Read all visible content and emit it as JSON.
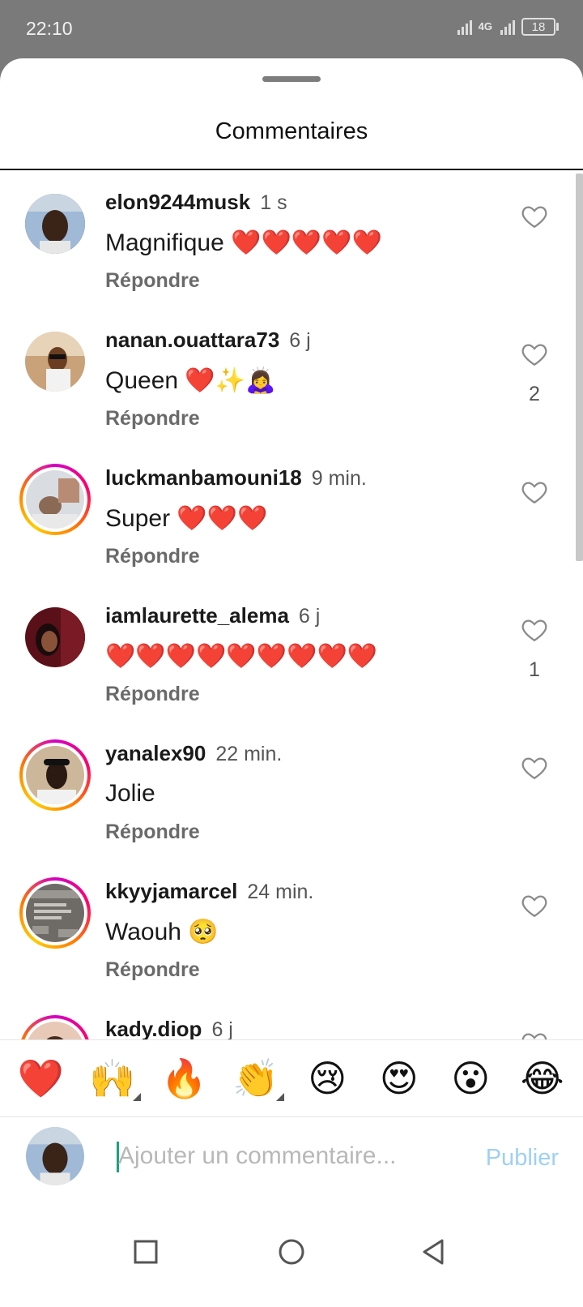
{
  "status_bar": {
    "time": "22:10",
    "network": "4G",
    "battery": "18"
  },
  "sheet": {
    "title": "Commentaires"
  },
  "comments": [
    {
      "username": "elon9244musk",
      "time": "1 s",
      "text": "Magnifique ❤️❤️❤️❤️❤️",
      "reply": "Répondre",
      "likes": ""
    },
    {
      "username": "nanan.ouattara73",
      "time": "6 j",
      "text": "Queen ❤️✨🙇‍♀️",
      "reply": "Répondre",
      "likes": "2"
    },
    {
      "username": "luckmanbamouni18",
      "time": "9 min.",
      "text": "Super ❤️❤️❤️",
      "reply": "Répondre",
      "likes": ""
    },
    {
      "username": "iamlaurette_alema",
      "time": "6 j",
      "text": "❤️❤️❤️❤️❤️❤️❤️❤️❤️",
      "reply": "Répondre",
      "likes": "1"
    },
    {
      "username": "yanalex90",
      "time": "22 min.",
      "text": "Jolie",
      "reply": "Répondre",
      "likes": ""
    },
    {
      "username": "kkyyjamarcel",
      "time": "24 min.",
      "text": "Waouh 🥺",
      "reply": "Répondre",
      "likes": ""
    },
    {
      "username": "kady.diop",
      "time": "6 j",
      "text": "",
      "reply": "",
      "likes": ""
    }
  ],
  "emoji_bar": [
    "❤️",
    "🙌",
    "🔥",
    "👏",
    "😢",
    "😍",
    "😮",
    "😂"
  ],
  "composer": {
    "placeholder": "Ajouter un commentaire...",
    "publish_label": "Publier"
  },
  "colors": {
    "publish_disabled": "#9fd0f4",
    "caret": "#1aa37a",
    "story_ring": "#d300c5"
  }
}
